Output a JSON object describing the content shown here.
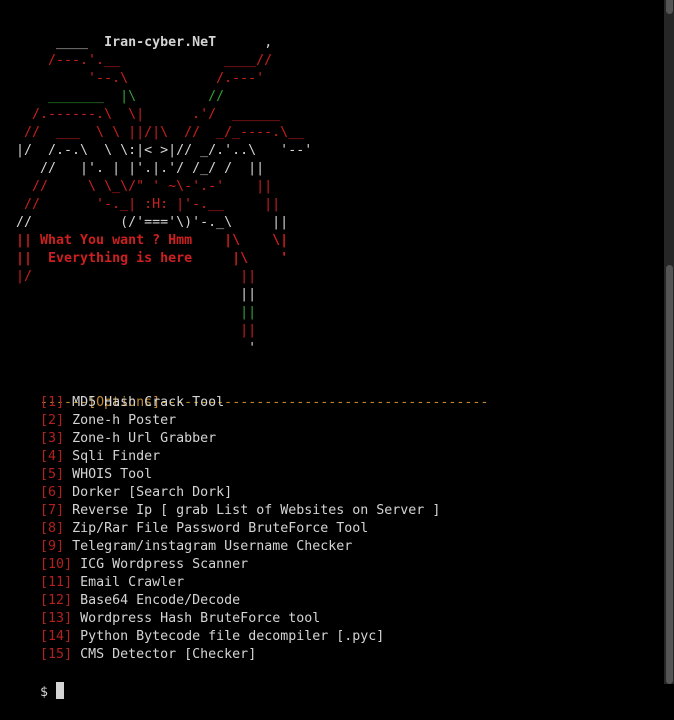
{
  "colors": {
    "background": "#000000",
    "text": "#d4d4d4",
    "red": "#cc1f1f",
    "green": "#36a036",
    "orange": "#c08a30",
    "option_number": "#b32020",
    "scrollbar": "#555555"
  },
  "banner": [
    {
      "segments": [
        {
          "t": "      ____  ",
          "c": "text"
        },
        {
          "t": "Iran-cyber.NeT",
          "c": "text",
          "b": true
        },
        {
          "t": "      ,",
          "c": "text"
        }
      ]
    },
    {
      "segments": [
        {
          "t": "     /---.'.__             ____//",
          "c": "red"
        }
      ]
    },
    {
      "segments": [
        {
          "t": "          '--.\\           /.---'",
          "c": "red"
        }
      ]
    },
    {
      "segments": [
        {
          "t": "     _______  ",
          "c": "green"
        },
        {
          "t": "|\\",
          "c": "green"
        },
        {
          "t": "         ",
          "c": "text"
        },
        {
          "t": "//",
          "c": "green"
        }
      ]
    },
    {
      "segments": [
        {
          "t": "   /.------.\\  \\|      .'/  ______",
          "c": "red"
        }
      ]
    },
    {
      "segments": [
        {
          "t": "  //  ___  \\ \\ ||/|\\  //  _/_----.\\__",
          "c": "red"
        }
      ]
    },
    {
      "segments": [
        {
          "t": " |/  /.-.\\  \\ \\:|< >|// _/.'..\\   '--'",
          "c": "text"
        }
      ]
    },
    {
      "segments": [
        {
          "t": "    //   |'. | |'.|.'/ /_/ /  ||",
          "c": "text"
        }
      ]
    },
    {
      "segments": [
        {
          "t": "   //     \\ \\_\\/\" ' ~\\-'.-'    ||",
          "c": "red"
        }
      ]
    },
    {
      "segments": [
        {
          "t": "  //       '-._| :H: |'-.__     ||",
          "c": "red"
        }
      ]
    },
    {
      "segments": [
        {
          "t": " //           (/'==='\\)'-._\\     ||",
          "c": "text"
        }
      ]
    },
    {
      "segments": [
        {
          "t": " || What You want ? Hmm    |\\    \\|",
          "c": "red",
          "b": true
        }
      ]
    },
    {
      "segments": [
        {
          "t": " ||  Everything is here     |\\    '",
          "c": "red",
          "b": true
        }
      ]
    },
    {
      "segments": [
        {
          "t": " |/                          ||",
          "c": "red"
        }
      ]
    },
    {
      "segments": [
        {
          "t": "                             ||",
          "c": "text"
        }
      ]
    },
    {
      "segments": [
        {
          "t": "                             ||",
          "c": "green"
        }
      ]
    },
    {
      "segments": [
        {
          "t": "                             ||",
          "c": "red"
        }
      ]
    },
    {
      "segments": [
        {
          "t": "                              '",
          "c": "text"
        }
      ]
    }
  ],
  "options_header": {
    "left": "------",
    "label": "[Options]",
    "right": "-----------------------------------------"
  },
  "options": [
    {
      "num": "1",
      "label": "MD5 Hash Crack Tool"
    },
    {
      "num": "2",
      "label": "Zone-h Poster"
    },
    {
      "num": "3",
      "label": "Zone-h Url Grabber"
    },
    {
      "num": "4",
      "label": "Sqli Finder"
    },
    {
      "num": "5",
      "label": "WHOIS Tool"
    },
    {
      "num": "6",
      "label": "Dorker [Search Dork]"
    },
    {
      "num": "7",
      "label": "Reverse Ip [ grab List of Websites on Server ]"
    },
    {
      "num": "8",
      "label": "Zip/Rar File Password BruteForce Tool"
    },
    {
      "num": "9",
      "label": "Telegram/instagram Username Checker"
    },
    {
      "num": "10",
      "label": "ICG Wordpress Scanner"
    },
    {
      "num": "11",
      "label": "Email Crawler"
    },
    {
      "num": "12",
      "label": "Base64 Encode/Decode"
    },
    {
      "num": "13",
      "label": "Wordpress Hash BruteForce tool"
    },
    {
      "num": "14",
      "label": "Python Bytecode file decompiler [.pyc]"
    },
    {
      "num": "15",
      "label": "CMS Detector [Checker]"
    }
  ],
  "prompt": {
    "symbol": "$ "
  }
}
